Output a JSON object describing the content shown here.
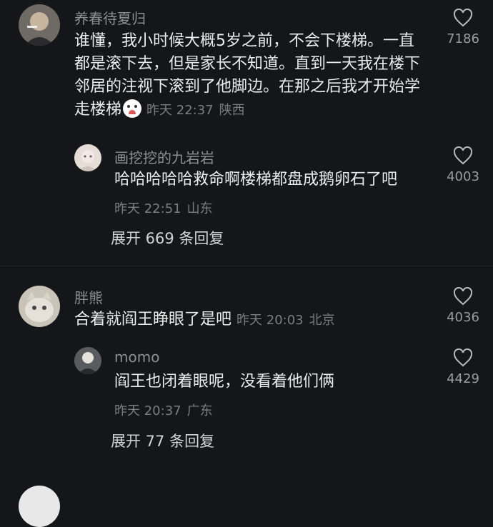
{
  "comments": [
    {
      "username": "养春待夏归",
      "text": "谁懂，我小时候大概5岁之前，不会下楼梯。一直都是滚下去，但是家长不知道。直到一天我在楼下邻居的注视下滚到了他脚边。在那之后我才开始学走楼梯",
      "emoji_icon": "crying-laughing-emoji-icon",
      "time": "昨天 22:37",
      "location": "陕西",
      "likes": "7186",
      "reply": {
        "username": "画挖挖的九岩岩",
        "text": "哈哈哈哈哈救命啊楼梯都盘成鹅卵石了吧",
        "time": "昨天 22:51",
        "location": "山东",
        "likes": "4003"
      },
      "expand_label": "展开 669 条回复"
    },
    {
      "username": "胖熊",
      "text": "合着就阎王睁眼了是吧",
      "time": "昨天 20:03",
      "location": "北京",
      "likes": "4036",
      "reply": {
        "username": "momo",
        "text": "阎王也闭着眼呢，没看着他们俩",
        "time": "昨天 20:37",
        "location": "广东",
        "likes": "4429"
      },
      "expand_label": "展开 77 条回复"
    }
  ],
  "colors": {
    "background": "#151619",
    "username": "#8e8f94",
    "body_text": "#ececec",
    "meta": "#7c7d82"
  }
}
